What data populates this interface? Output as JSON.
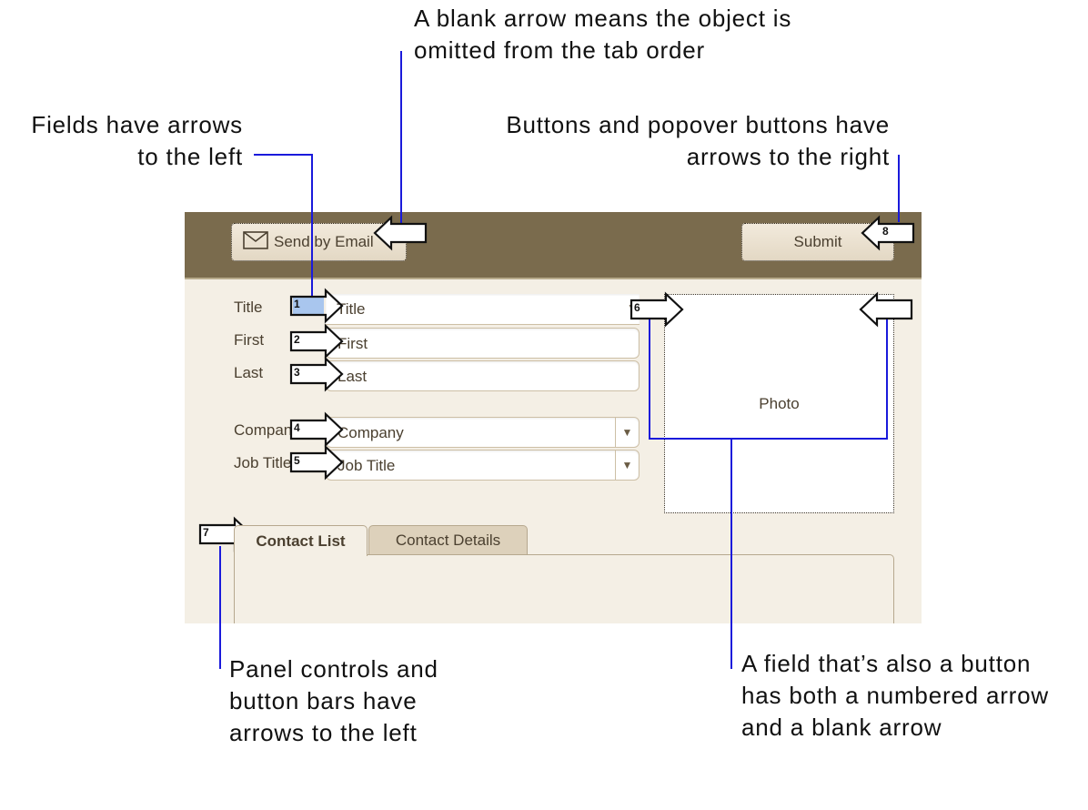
{
  "callouts": {
    "blank_arrow": [
      "A blank arrow means the object is",
      "omitted from the tab order"
    ],
    "fields_left": [
      "Fields have arrows",
      "to the left"
    ],
    "buttons_right": [
      "Buttons and popover buttons have",
      "arrows to the right"
    ],
    "panel_controls": [
      "Panel controls and",
      "button bars have",
      "arrows to the left"
    ],
    "field_button": [
      "A field that’s also a button",
      "has both a numbered arrow",
      "and a blank arrow"
    ]
  },
  "toolbar": {
    "send_label": "Send by Email",
    "send_icon": "envelope-icon",
    "submit_label": "Submit"
  },
  "form": {
    "title": {
      "label": "Title",
      "value": "Title"
    },
    "first": {
      "label": "First",
      "value": "First"
    },
    "last": {
      "label": "Last",
      "value": "Last"
    },
    "company": {
      "label": "Company",
      "value": "Company"
    },
    "job_title": {
      "label": "Job Title",
      "value": "Job Title"
    },
    "dropdown_glyph": "▼"
  },
  "photo": {
    "label": "Photo"
  },
  "tabs": [
    {
      "label": "Contact List",
      "active": true
    },
    {
      "label": "Contact Details",
      "active": false
    }
  ],
  "tab_order_numbers": [
    "1",
    "2",
    "3",
    "4",
    "5",
    "6",
    "7",
    "8"
  ],
  "colors": {
    "header_bg": "#7a6b4d",
    "layout_bg": "#f4efe5",
    "leader_line": "#1a1adb",
    "highlight": "#a9c6ee"
  }
}
